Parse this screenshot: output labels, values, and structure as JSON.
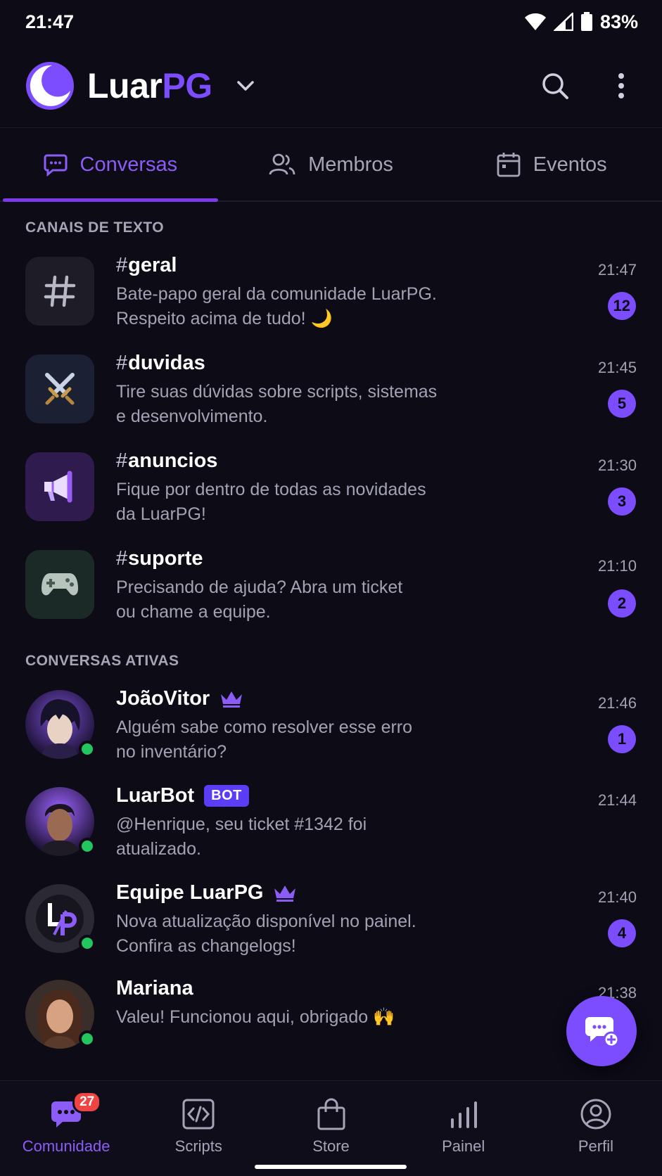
{
  "status_bar": {
    "time": "21:47",
    "battery": "83%"
  },
  "header": {
    "brand_main": "Luar",
    "brand_accent": "PG"
  },
  "tabs": [
    {
      "label": "Conversas",
      "icon": "chat-bubble-icon",
      "active": true
    },
    {
      "label": "Membros",
      "icon": "users-icon",
      "active": false
    },
    {
      "label": "Eventos",
      "icon": "calendar-icon",
      "active": false
    }
  ],
  "sections": {
    "text_channels": "CANAIS DE TEXTO",
    "active_conversations": "CONVERSAS ATIVAS"
  },
  "channels": [
    {
      "hash": "#",
      "name": "geral",
      "line1": "Bate-papo geral da comunidade LuarPG.",
      "line2": "Respeito acima de tudo! 🌙",
      "time": "21:47",
      "unread": "12",
      "icon": "hash-icon"
    },
    {
      "hash": "#",
      "name": "duvidas",
      "line1": "Tire suas dúvidas sobre scripts, sistemas",
      "line2": "e desenvolvimento.",
      "time": "21:45",
      "unread": "5",
      "icon": "crossed-swords-icon"
    },
    {
      "hash": "#",
      "name": "anuncios",
      "line1": "Fique por dentro de todas as novidades",
      "line2": "da LuarPG!",
      "time": "21:30",
      "unread": "3",
      "icon": "megaphone-icon"
    },
    {
      "hash": "#",
      "name": "suporte",
      "line1": "Precisando de ajuda? Abra um ticket",
      "line2": "ou chame a equipe.",
      "time": "21:10",
      "unread": "2",
      "icon": "gamepad-icon"
    }
  ],
  "conversations": [
    {
      "name": "JoãoVitor",
      "line1": "Alguém sabe como resolver esse erro",
      "line2": "no inventário?",
      "time": "21:46",
      "unread": "1"
    },
    {
      "name": "LuarBot",
      "tag": "BOT",
      "line1": "@Henrique, seu ticket #1342 foi",
      "line2": "atualizado.",
      "time": "21:44"
    },
    {
      "name": "Equipe LuarPG",
      "logo_text": "LP",
      "line1": "Nova atualização disponível no painel.",
      "line2": "Confira as changelogs!",
      "time": "21:40",
      "unread": "4"
    },
    {
      "name": "Mariana",
      "line1": "Valeu! Funcionou aqui, obrigado 🙌",
      "time": "21:38"
    }
  ],
  "bottom_nav": [
    {
      "label": "Comunidade",
      "icon": "community-chat-icon",
      "badge": "27",
      "active": true
    },
    {
      "label": "Scripts",
      "icon": "code-icon",
      "active": false
    },
    {
      "label": "Store",
      "icon": "shopping-bag-icon",
      "active": false
    },
    {
      "label": "Painel",
      "icon": "bar-chart-icon",
      "active": false
    },
    {
      "label": "Perfil",
      "icon": "user-circle-icon",
      "active": false
    }
  ],
  "colors": {
    "accent": "#7c4dff",
    "background": "#0c0b16",
    "online": "#22c55e",
    "nav_badge": "#ef4444"
  }
}
